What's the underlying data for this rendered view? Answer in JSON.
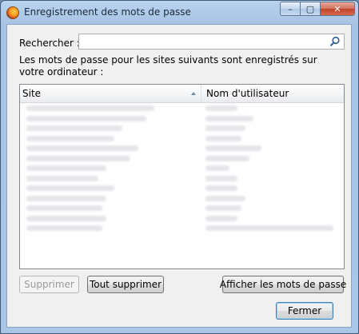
{
  "window": {
    "title": "Enregistrement des mots de passe"
  },
  "caption_buttons": {
    "minimize_glyph": "–",
    "maximize_glyph": "▢",
    "close_glyph": "✕"
  },
  "search": {
    "label": "Rechercher :",
    "value": "",
    "placeholder": ""
  },
  "description": "Les mots de passe pour les sites suivants sont enregistrés sur votre ordinateur :",
  "table": {
    "columns": [
      "Site",
      "Nom d'utilisateur"
    ],
    "sorted_column": "Site",
    "sort_direction": "ascending"
  },
  "buttons": {
    "delete": "Supprimer",
    "delete_all": "Tout supprimer",
    "show_passwords": "Afficher les mots de passe",
    "close": "Fermer"
  },
  "icons": {
    "app": "firefox-icon",
    "search": "magnifier-icon",
    "sort": "sort-ascending-icon"
  }
}
